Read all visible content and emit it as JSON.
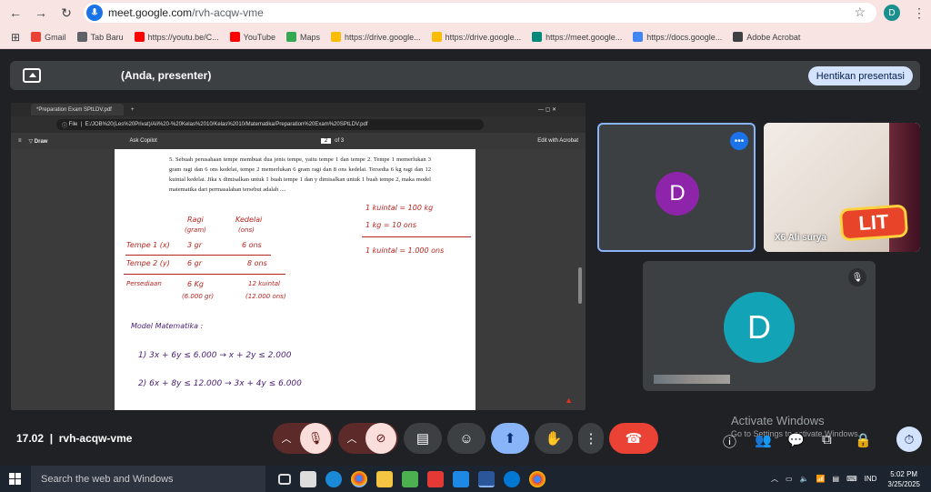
{
  "browser": {
    "url_domain": "meet.google.com",
    "url_path": "/rvh-acqw-vme",
    "profile_initial": "D",
    "bookmarks": [
      {
        "label": "Gmail",
        "color": "#ea4335"
      },
      {
        "label": "Tab Baru",
        "color": "#5f6368"
      },
      {
        "label": "https://youtu.be/C...",
        "color": "#ff0000"
      },
      {
        "label": "YouTube",
        "color": "#ff0000"
      },
      {
        "label": "Maps",
        "color": "#34a853"
      },
      {
        "label": "https://drive.google...",
        "color": "#fbbc04"
      },
      {
        "label": "https://drive.google...",
        "color": "#fbbc04"
      },
      {
        "label": "https://meet.google...",
        "color": "#00897b"
      },
      {
        "label": "https://docs.google...",
        "color": "#4285f4"
      },
      {
        "label": "Adobe Acrobat",
        "color": "#3c4043"
      }
    ]
  },
  "meet": {
    "presenter_label": "(Anda, presenter)",
    "stop_presenting": "Hentikan presentasi",
    "time": "17.02",
    "meeting_code": "rvh-acqw-vme",
    "participants": [
      {
        "initial": "D",
        "color": "#8e24aa"
      },
      {
        "name": "X6 Ali surya",
        "sticker": "LIT"
      },
      {
        "initial": "D",
        "color": "#12a4b6"
      }
    ],
    "activate_title": "Activate Windows",
    "activate_sub": "Go to Settings to activate Windows."
  },
  "pdf": {
    "tab_title": "*Preparation Exam SPtLDV.pdf",
    "address_label": "File",
    "address": "E:/JOB%20(Les%20Privat)/Ali%20-%20Kelas%2010/Kelas%2010/Matematika/Preparation%20Exam%20SPtLDV.pdf",
    "draw_label": "Draw",
    "ask_copilot": "Ask Copilot",
    "page_current": "2",
    "page_total": "of 3",
    "edit_label": "Edit with Acrobat",
    "question": "5.  Sebuah perusahaan tempe membuat dua jenis tempe, yaitu tempe 1 dan tempe 2. Tempe 1 memerlukan 3 gram ragi dan 6 ons kedelai, tempe 2 memerlukan 6 gram ragi dan 8 ons kedelai. Tersedia 6 kg ragi dan 12 kuintal kedelai. Jika x dimisalkan untuk 1 buah tempe 1 dan y dimisalkan untuk 1 buah tempe 2, maka model matematika dari permasalahan tersebut adalah ....",
    "notes": {
      "h_ragi": "Ragi",
      "h_ragi_unit": "(gram)",
      "h_kedelai": "Kedelai",
      "h_kedelai_unit": "(ons)",
      "r1_label": "Tempe 1 (x)",
      "r1_ragi": "3 gr",
      "r1_kedelai": "6 ons",
      "r2_label": "Tempe 2 (y)",
      "r2_ragi": "6 gr",
      "r2_kedelai": "8 ons",
      "r3_label": "Persediaan",
      "r3_ragi": "6 Kg",
      "r3_ragi_conv": "(6.000 gr)",
      "r3_kedelai": "12 kuintal",
      "r3_kedelai_conv": "(12.000 ons)",
      "conv1": "1 kuintal = 100 kg",
      "conv2": "1 kg = 10 ons",
      "conv3": "1 kuintal = 1.000 ons",
      "model_title": "Model Matematika :",
      "eq1": "1)  3x + 6y ≤ 6.000   →   x + 2y ≤ 2.000",
      "eq2": "2)  6x + 8y ≤ 12.000  →  3x + 4y ≤ 6.000"
    }
  },
  "taskbar": {
    "search_placeholder": "Search the web and Windows",
    "lang": "IND",
    "time": "5:02 PM",
    "date": "3/25/2025"
  }
}
